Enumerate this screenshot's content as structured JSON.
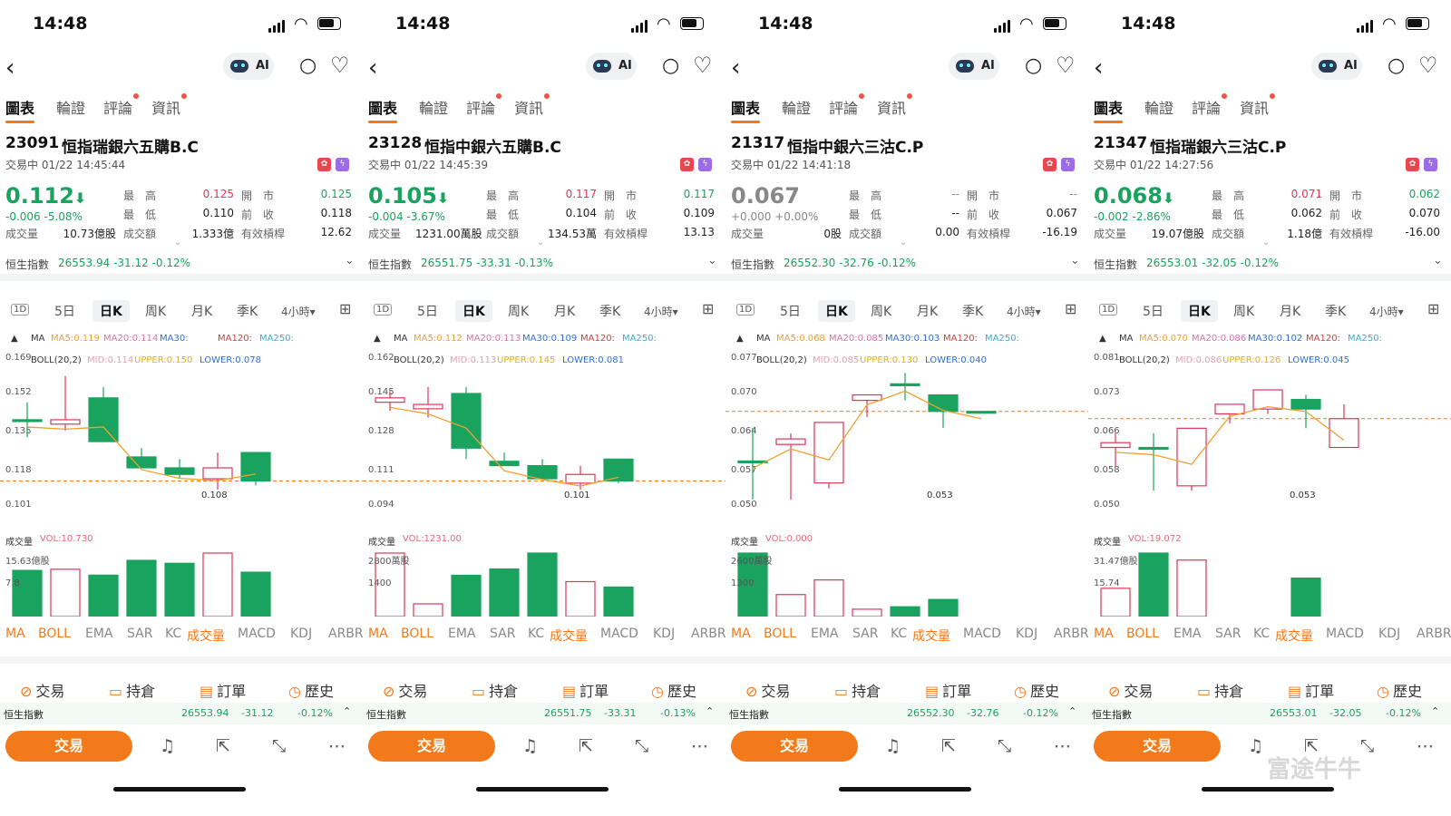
{
  "common": {
    "time": "14:48",
    "ai_label": "AI",
    "tabs": [
      "圖表",
      "輪證",
      "評論",
      "資訊"
    ],
    "labels": {
      "high": "最　高",
      "low": "最　低",
      "open": "開　市",
      "prev": "前　收",
      "volume": "成交量",
      "turnover": "成交額",
      "eff_lev": "有效槓桿"
    },
    "periods": [
      "1D",
      "5日",
      "日K",
      "周K",
      "月K",
      "季K",
      "4小時▾"
    ],
    "index_name": "恒生指數",
    "ma_label": "MA",
    "boll_label": "BOLL(20,2)",
    "vol_label": "成交量",
    "indicator_tabs": [
      "MA",
      "BOLL",
      "EMA",
      "SAR",
      "KC",
      "成交量",
      "MACD",
      "KDJ",
      "ARBR"
    ],
    "actions": [
      "交易",
      "持倉",
      "訂單",
      "歷史"
    ],
    "trade_button": "交易",
    "watermark": "富途牛牛",
    "colors": {
      "up": "#e0355a",
      "down": "#1aa35f",
      "accent": "#f27a1a"
    }
  },
  "panels": [
    {
      "code": "23091",
      "name": "恒指瑞銀六五購B.C",
      "status": "交易中 01/22 14:45:44",
      "price": "0.112",
      "dir": "down",
      "price_arrow": "⬇",
      "change": "-0.006 -5.08%",
      "high": "0.125",
      "low": "0.110",
      "open": "0.125",
      "prev": "0.118",
      "volume": "10.73億股",
      "turnover": "1.333億",
      "eff_lev": "12.62",
      "index_line": "26553.94 -31.12 -0.12%",
      "index_val": "26553.94",
      "index_chg": "-31.12",
      "index_pct": "-0.12%",
      "ma": {
        "ma5": "MA5:0.119",
        "ma20": "MA20:0.114",
        "ma30": "MA30:",
        "ma120": "MA120:",
        "ma250": "MA250:"
      },
      "boll": {
        "mid": "MID:0.114",
        "upper": "UPPER:0.150",
        "lower": "LOWER:0.078"
      },
      "yticks": [
        "0.169",
        "0.152",
        "0.135",
        "0.118",
        "0.101"
      ],
      "low_label": "0.108",
      "vol_value": "VOL:10.730",
      "vol_ticks": [
        "15.63億股",
        "7.8"
      ],
      "chart_data": {
        "type": "candlestick",
        "ylim": [
          0.101,
          0.169
        ],
        "candles": [
          {
            "o": 0.14,
            "h": 0.148,
            "l": 0.132,
            "c": 0.14
          },
          {
            "o": 0.138,
            "h": 0.16,
            "l": 0.135,
            "c": 0.14
          },
          {
            "o": 0.15,
            "h": 0.155,
            "l": 0.132,
            "c": 0.13
          },
          {
            "o": 0.123,
            "h": 0.127,
            "l": 0.118,
            "c": 0.118
          },
          {
            "o": 0.118,
            "h": 0.122,
            "l": 0.113,
            "c": 0.115
          },
          {
            "o": 0.113,
            "h": 0.125,
            "l": 0.108,
            "c": 0.118
          },
          {
            "o": 0.125,
            "h": 0.125,
            "l": 0.11,
            "c": 0.112
          }
        ],
        "volumes": [
          7.8,
          8,
          7,
          9.5,
          9,
          10.73,
          7.5
        ]
      }
    },
    {
      "code": "23128",
      "name": "恒指中銀六五購B.C",
      "status": "交易中 01/22 14:45:39",
      "price": "0.105",
      "dir": "down",
      "price_arrow": "⬇",
      "change": "-0.004 -3.67%",
      "high": "0.117",
      "low": "0.104",
      "open": "0.117",
      "prev": "0.109",
      "volume": "1231.00萬股",
      "turnover": "134.53萬",
      "eff_lev": "13.13",
      "index_line": "26551.75 -33.31 -0.13%",
      "index_val": "26551.75",
      "index_chg": "-33.31",
      "index_pct": "-0.13%",
      "ma": {
        "ma5": "MA5:0.112",
        "ma20": "MA20:0.113",
        "ma30": "MA30:0.109",
        "ma120": "MA120:",
        "ma250": "MA250:"
      },
      "boll": {
        "mid": "MID:0.113",
        "upper": "UPPER:0.145",
        "lower": "LOWER:0.081"
      },
      "yticks": [
        "0.162",
        "0.145",
        "0.128",
        "0.111",
        "0.094"
      ],
      "low_label": "0.101",
      "vol_value": "VOL:1231.00",
      "vol_ticks": [
        "2800萬股",
        "1400"
      ],
      "chart_data": {
        "type": "candlestick",
        "ylim": [
          0.094,
          0.162
        ],
        "candles": [
          {
            "o": 0.141,
            "h": 0.146,
            "l": 0.137,
            "c": 0.143
          },
          {
            "o": 0.138,
            "h": 0.148,
            "l": 0.134,
            "c": 0.14
          },
          {
            "o": 0.145,
            "h": 0.148,
            "l": 0.115,
            "c": 0.12
          },
          {
            "o": 0.114,
            "h": 0.118,
            "l": 0.112,
            "c": 0.112
          },
          {
            "o": 0.112,
            "h": 0.115,
            "l": 0.106,
            "c": 0.106
          },
          {
            "o": 0.104,
            "h": 0.112,
            "l": 0.101,
            "c": 0.108
          },
          {
            "o": 0.115,
            "h": 0.115,
            "l": 0.104,
            "c": 0.105
          }
        ],
        "volumes": [
          2000,
          400,
          1300,
          1500,
          2000,
          1100,
          930
        ]
      }
    },
    {
      "code": "21317",
      "name": "恒指中銀六三沽C.P",
      "status": "交易中 01/22 14:41:18",
      "price": "0.067",
      "dir": "flat",
      "price_arrow": "",
      "change": "+0.000 +0.00%",
      "high": "--",
      "low": "--",
      "open": "--",
      "prev": "0.067",
      "volume": "0股",
      "turnover": "0.00",
      "eff_lev": "-16.19",
      "index_line": "26552.30 -32.76 -0.12%",
      "index_val": "26552.30",
      "index_chg": "-32.76",
      "index_pct": "-0.12%",
      "ma": {
        "ma5": "MA5:0.068",
        "ma20": "MA20:0.085",
        "ma30": "MA30:0.103",
        "ma120": "MA120:",
        "ma250": "MA250:"
      },
      "boll": {
        "mid": "MID:0.085",
        "upper": "UPPER:0.130",
        "lower": "LOWER:0.040"
      },
      "yticks": [
        "0.077",
        "0.070",
        "0.064",
        "0.057",
        "0.050"
      ],
      "low_label": "0.053",
      "vol_value": "VOL:0.000",
      "vol_ticks": [
        "2600萬股",
        "1300"
      ],
      "chart_data": {
        "type": "candlestick",
        "ylim": [
          0.05,
          0.077
        ],
        "candles": [
          {
            "o": 0.058,
            "h": 0.064,
            "l": 0.051,
            "c": 0.058
          },
          {
            "o": 0.061,
            "h": 0.063,
            "l": 0.051,
            "c": 0.062
          },
          {
            "o": 0.054,
            "h": 0.065,
            "l": 0.053,
            "c": 0.065
          },
          {
            "o": 0.069,
            "h": 0.07,
            "l": 0.066,
            "c": 0.07
          },
          {
            "o": 0.072,
            "h": 0.074,
            "l": 0.069,
            "c": 0.072
          },
          {
            "o": 0.07,
            "h": 0.07,
            "l": 0.064,
            "c": 0.067
          },
          {
            "o": 0.067,
            "h": 0.067,
            "l": 0.067,
            "c": 0.067
          }
        ],
        "volumes": [
          2600,
          900,
          1500,
          300,
          400,
          700,
          0
        ]
      }
    },
    {
      "code": "21347",
      "name": "恒指瑞銀六三沽C.P",
      "status": "交易中 01/22 14:27:56",
      "price": "0.068",
      "dir": "down",
      "price_arrow": "⬇",
      "change": "-0.002 -2.86%",
      "high": "0.071",
      "low": "0.062",
      "open": "0.062",
      "prev": "0.070",
      "volume": "19.07億股",
      "turnover": "1.18億",
      "eff_lev": "-16.00",
      "index_line": "26553.01 -32.05 -0.12%",
      "index_val": "26553.01",
      "index_chg": "-32.05",
      "index_pct": "-0.12%",
      "ma": {
        "ma5": "MA5:0.070",
        "ma20": "MA20:0.086",
        "ma30": "MA30:0.102",
        "ma120": "MA120:",
        "ma250": "MA250:"
      },
      "boll": {
        "mid": "MID:0.086",
        "upper": "UPPER:0.126",
        "lower": "LOWER:0.045"
      },
      "yticks": [
        "0.081",
        "0.073",
        "0.066",
        "0.058",
        "0.050"
      ],
      "low_label": "0.053",
      "vol_value": "VOL:19.072",
      "vol_ticks": [
        "31.47億股",
        "15.74"
      ],
      "chart_data": {
        "type": "candlestick",
        "ylim": [
          0.05,
          0.081
        ],
        "candles": [
          {
            "o": 0.062,
            "h": 0.065,
            "l": 0.058,
            "c": 0.063
          },
          {
            "o": 0.062,
            "h": 0.065,
            "l": 0.053,
            "c": 0.062
          },
          {
            "o": 0.054,
            "h": 0.066,
            "l": 0.053,
            "c": 0.066
          },
          {
            "o": 0.069,
            "h": 0.071,
            "l": 0.067,
            "c": 0.071
          },
          {
            "o": 0.07,
            "h": 0.074,
            "l": 0.069,
            "c": 0.074
          },
          {
            "o": 0.072,
            "h": 0.073,
            "l": 0.066,
            "c": 0.07
          },
          {
            "o": 0.062,
            "h": 0.071,
            "l": 0.062,
            "c": 0.068
          }
        ],
        "volumes": [
          14,
          31.47,
          28,
          0,
          0,
          19.07,
          0
        ]
      }
    }
  ]
}
